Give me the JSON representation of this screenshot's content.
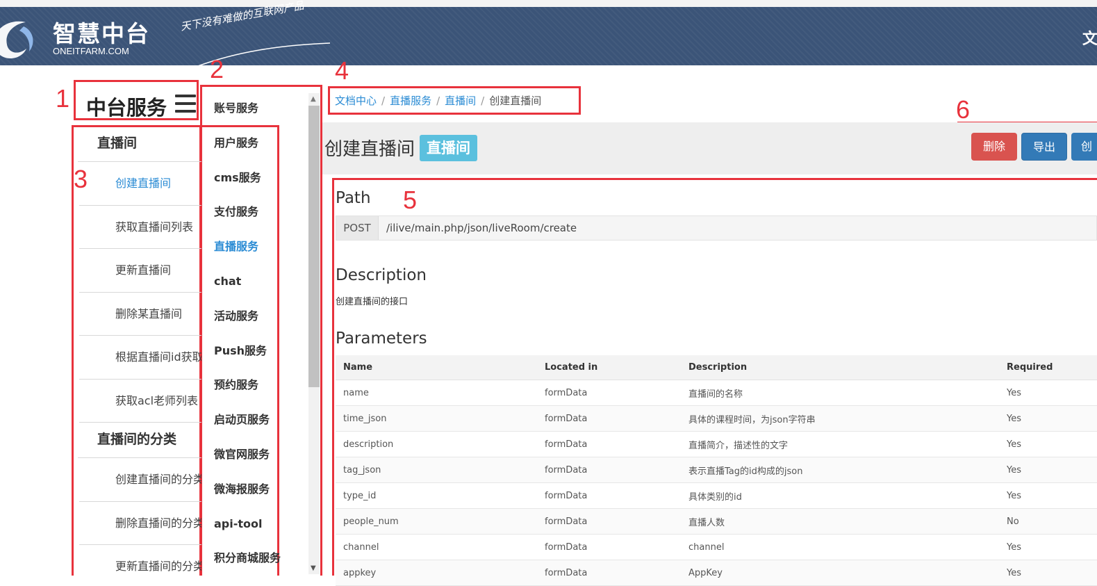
{
  "header": {
    "logo_title": "智慧中台",
    "logo_subtitle": "ONEITFARM.COM",
    "slogan": "天下没有难做的互联网产品",
    "right_cut_text": "文"
  },
  "annotations": [
    "1",
    "2",
    "3",
    "4",
    "5",
    "6"
  ],
  "sidebar": {
    "title": "中台服务",
    "groups": [
      {
        "label": "直播间",
        "items": [
          {
            "label": "创建直播间",
            "active": true
          },
          {
            "label": "获取直播间列表"
          },
          {
            "label": "更新直播间"
          },
          {
            "label": "删除某直播间"
          },
          {
            "label": "根据直播间id获取"
          },
          {
            "label": "获取acl老师列表"
          }
        ]
      },
      {
        "label": "直播间的分类",
        "items": [
          {
            "label": "创建直播间的分类"
          },
          {
            "label": "删除直播间的分类"
          },
          {
            "label": "更新直播间的分类"
          }
        ]
      }
    ]
  },
  "categories": [
    {
      "label": "账号服务"
    },
    {
      "label": "用户服务"
    },
    {
      "label": "cms服务"
    },
    {
      "label": "支付服务"
    },
    {
      "label": "直播服务",
      "active": true
    },
    {
      "label": "chat"
    },
    {
      "label": "活动服务"
    },
    {
      "label": "Push服务"
    },
    {
      "label": "预约服务"
    },
    {
      "label": "启动页服务"
    },
    {
      "label": "微官网服务"
    },
    {
      "label": "微海报服务"
    },
    {
      "label": "api-tool"
    },
    {
      "label": "积分商城服务"
    }
  ],
  "breadcrumb": {
    "items": [
      "文档中心",
      "直播服务",
      "直播间"
    ],
    "current": "创建直播间",
    "separator": "/"
  },
  "page": {
    "title": "创建直播间",
    "badge": "直播间",
    "buttons": {
      "delete": "删除",
      "export": "导出",
      "create_cut": "创"
    }
  },
  "api": {
    "path_heading": "Path",
    "method": "POST",
    "url": "/ilive/main.php/json/liveRoom/create",
    "description_heading": "Description",
    "description": "创建直播间的接口",
    "parameters_heading": "Parameters",
    "columns": [
      "Name",
      "Located in",
      "Description",
      "Required"
    ],
    "rows": [
      [
        "name",
        "formData",
        "直播间的名称",
        "Yes"
      ],
      [
        "time_json",
        "formData",
        "具体的课程时间，为json字符串",
        "Yes"
      ],
      [
        "description",
        "formData",
        "直播简介，描述性的文字",
        "Yes"
      ],
      [
        "tag_json",
        "formData",
        "表示直播Tag的id构成的json",
        "Yes"
      ],
      [
        "type_id",
        "formData",
        "具体类别的id",
        "Yes"
      ],
      [
        "people_num",
        "formData",
        "直播人数",
        "No"
      ],
      [
        "channel",
        "formData",
        "channel",
        "Yes"
      ],
      [
        "appkey",
        "formData",
        "AppKey",
        "Yes"
      ]
    ]
  },
  "colors": {
    "header_bg": "#3b5478",
    "annotation_red": "#e8323c",
    "link_blue": "#2a8bd4",
    "badge_cyan": "#5bc0de",
    "danger_red": "#d9534f",
    "primary_blue": "#337ab7"
  },
  "icons": {
    "logo": "swirl-logo-icon",
    "menu": "hamburger-menu-icon",
    "scroll_up": "triangle-up-icon",
    "scroll_down": "triangle-down-icon"
  }
}
